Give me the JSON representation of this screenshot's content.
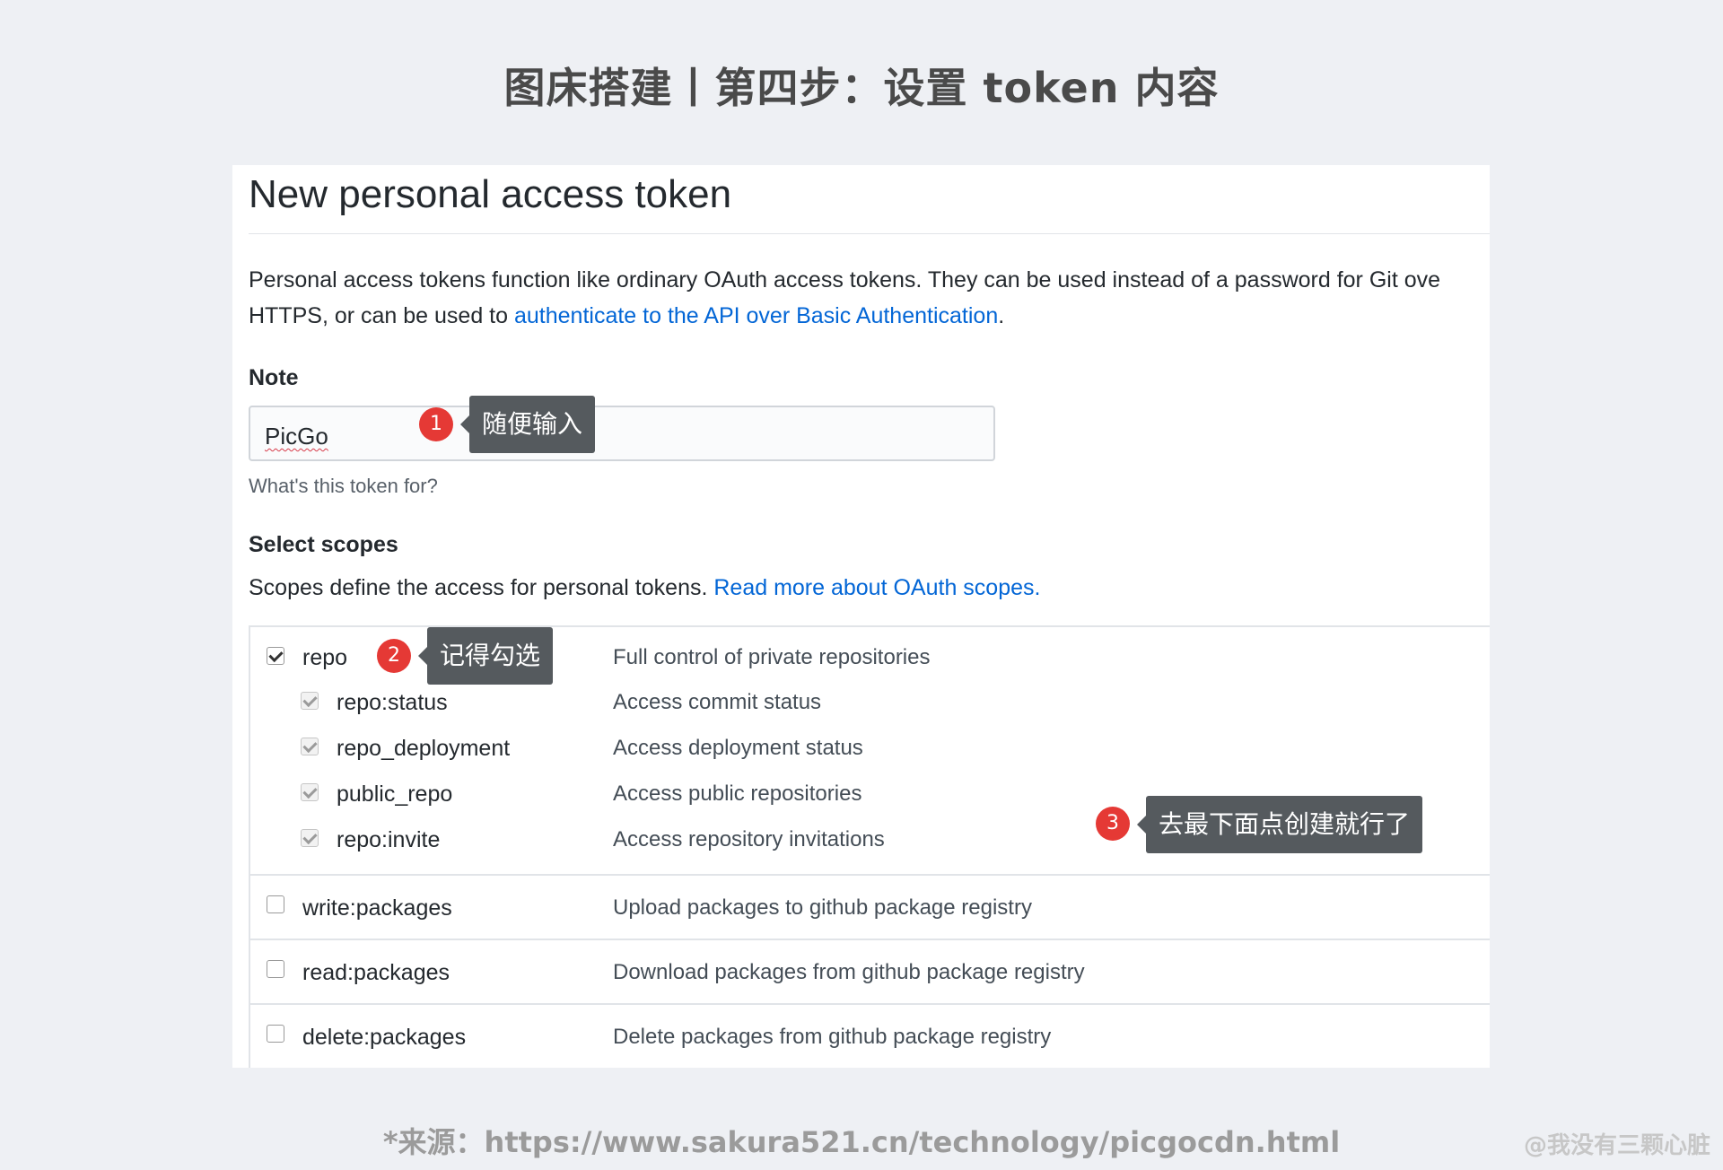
{
  "page": {
    "title": "图床搭建丨第四步：设置 token 内容",
    "source": "*来源：https://www.sakura521.cn/technology/picgocdn.html",
    "watermark": "@我没有三颗心脏"
  },
  "form": {
    "heading": "New personal access token",
    "intro_line1": "Personal access tokens function like ordinary OAuth access tokens. They can be used instead of a password for Git ove",
    "intro_line2_prefix": "HTTPS, or can be used to ",
    "intro_link": "authenticate to the API over Basic Authentication",
    "intro_suffix": ".",
    "note_label": "Note",
    "note_value": "PicGo",
    "note_hint": "What's this token for?",
    "scopes_label": "Select scopes",
    "scopes_desc_prefix": "Scopes define the access for personal tokens. ",
    "scopes_link": "Read more about OAuth scopes."
  },
  "scopes": {
    "repo": {
      "name": "repo",
      "desc": "Full control of private repositories",
      "checked": true
    },
    "repo_sub": [
      {
        "name": "repo:status",
        "desc": "Access commit status",
        "checked": true
      },
      {
        "name": "repo_deployment",
        "desc": "Access deployment status",
        "checked": true
      },
      {
        "name": "public_repo",
        "desc": "Access public repositories",
        "checked": true
      },
      {
        "name": "repo:invite",
        "desc": "Access repository invitations",
        "checked": true
      }
    ],
    "write_packages": {
      "name": "write:packages",
      "desc": "Upload packages to github package registry",
      "checked": false
    },
    "read_packages": {
      "name": "read:packages",
      "desc": "Download packages from github package registry",
      "checked": false
    },
    "delete_packages": {
      "name": "delete:packages",
      "desc": "Delete packages from github package registry",
      "checked": false
    }
  },
  "annotations": {
    "a1": {
      "number": "1",
      "text": "随便输入"
    },
    "a2": {
      "number": "2",
      "text": "记得勾选"
    },
    "a3": {
      "number": "3",
      "text": "去最下面点创建就行了"
    }
  },
  "colors": {
    "link": "#0366d6",
    "badge": "#e53935",
    "callout": "#555a5e",
    "background": "#eef0f4"
  }
}
